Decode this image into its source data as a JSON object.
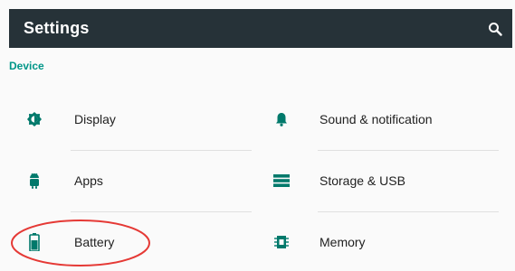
{
  "toolbar": {
    "title": "Settings",
    "search_icon": "search-icon",
    "background": "#263238"
  },
  "section": {
    "label": "Device",
    "color": "#009688"
  },
  "items": [
    {
      "label": "Display",
      "icon": "brightness-icon"
    },
    {
      "label": "Sound & notification",
      "icon": "bell-icon"
    },
    {
      "label": "Apps",
      "icon": "android-icon"
    },
    {
      "label": "Storage & USB",
      "icon": "storage-icon"
    },
    {
      "label": "Battery",
      "icon": "battery-icon"
    },
    {
      "label": "Memory",
      "icon": "memory-chip-icon"
    }
  ],
  "annotation": {
    "shape": "ellipse",
    "color": "#e53935",
    "target": "Battery"
  },
  "colors": {
    "icon": "#00796b",
    "text": "#212121",
    "divider": "#e0e0e0"
  }
}
